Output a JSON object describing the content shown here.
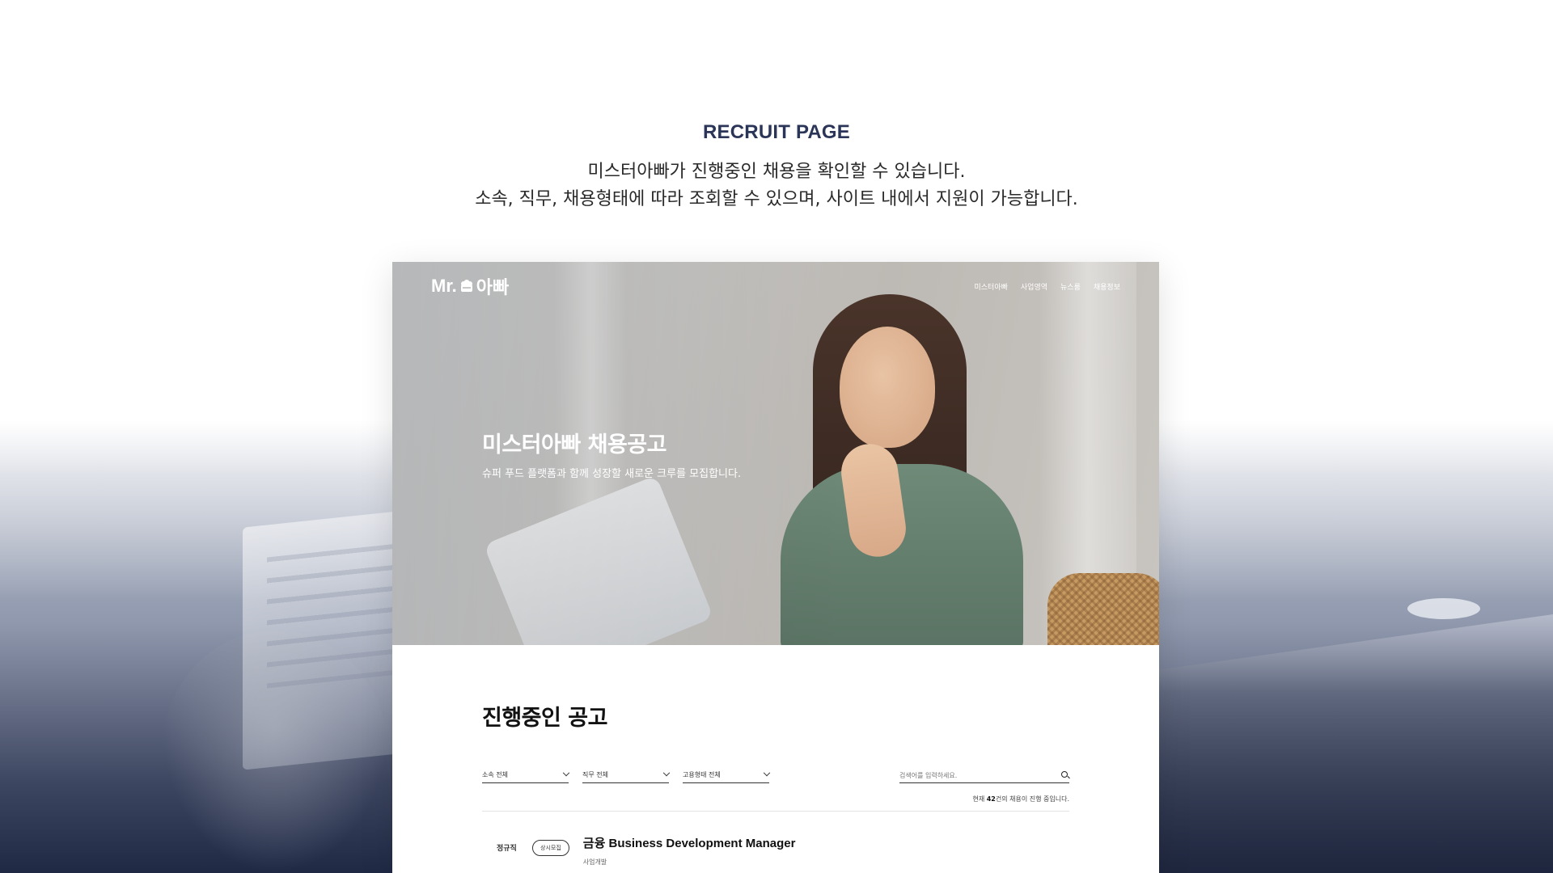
{
  "intro": {
    "title": "RECRUIT PAGE",
    "line1": "미스터아빠가 진행중인 채용을 확인할 수 있습니다.",
    "line2": "소속, 직무, 채용형태에 따라 조회할 수 있으며, 사이트 내에서 지원이 가능합니다."
  },
  "site": {
    "logo_text": "Mr.",
    "logo_korean": "아빠",
    "nav": [
      "미스터아빠",
      "사업영역",
      "뉴스룸",
      "채용정보"
    ]
  },
  "hero": {
    "title": "미스터아빠 채용공고",
    "subtitle": "슈퍼 푸드 플랫폼과 함께 성장할 새로운 크루를 모집합니다."
  },
  "listing": {
    "section_title": "진행중인 공고",
    "filters": [
      "소속 전체",
      "직무 전체",
      "고용형태 전체"
    ],
    "search_placeholder": "검색어를 입력하세요.",
    "count_prefix": "현재 ",
    "count_value": "42",
    "count_suffix": "건의 채용이 진행 중입니다."
  },
  "jobs": [
    {
      "type": "정규직",
      "badge": "상시모집",
      "title": "금융 Business Development Manager",
      "department": "사업개발"
    }
  ],
  "colors": {
    "intro_title": "#2b3558",
    "background_dark": "#1f2944"
  }
}
